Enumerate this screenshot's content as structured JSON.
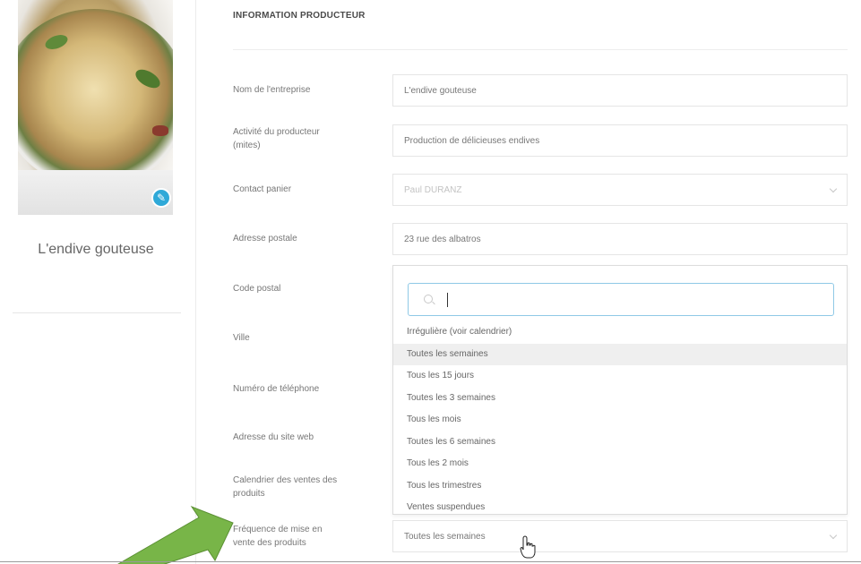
{
  "producer": {
    "name": "L'endive gouteuse"
  },
  "section": {
    "title": "INFORMATION PRODUCTEUR"
  },
  "form": {
    "company_name": {
      "label": "Nom de l'entreprise",
      "value": "L'endive gouteuse"
    },
    "activity": {
      "label_line1": "Activité du producteur",
      "label_line2": "(mites)",
      "value": "Production de délicieuses endives"
    },
    "contact": {
      "label": "Contact panier",
      "value": "Paul DURANZ"
    },
    "address": {
      "label": "Adresse postale",
      "value": "23 rue des albatros"
    },
    "postal_code": {
      "label": "Code postal"
    },
    "city": {
      "label": "Ville"
    },
    "phone": {
      "label": "Numéro de téléphone"
    },
    "website": {
      "label": "Adresse du site web"
    },
    "calendar": {
      "label_line1": "Calendrier des ventes des",
      "label_line2": "produits"
    },
    "frequency": {
      "label_line1": "Fréquence de mise en",
      "label_line2": "vente des produits",
      "value": "Toutes les semaines"
    }
  },
  "dropdown": {
    "search_value": "",
    "options": [
      "Irrégulière (voir calendrier)",
      "Toutes les semaines",
      "Tous les 15 jours",
      "Toutes les 3 semaines",
      "Tous les mois",
      "Toutes les 6 semaines",
      "Tous les 2 mois",
      "Tous les trimestres",
      "Ventes suspendues"
    ],
    "selected_index": 1
  },
  "colors": {
    "accent": "#2fa9d8",
    "arrow": "#78b548",
    "search_border": "#8fc9e6"
  }
}
